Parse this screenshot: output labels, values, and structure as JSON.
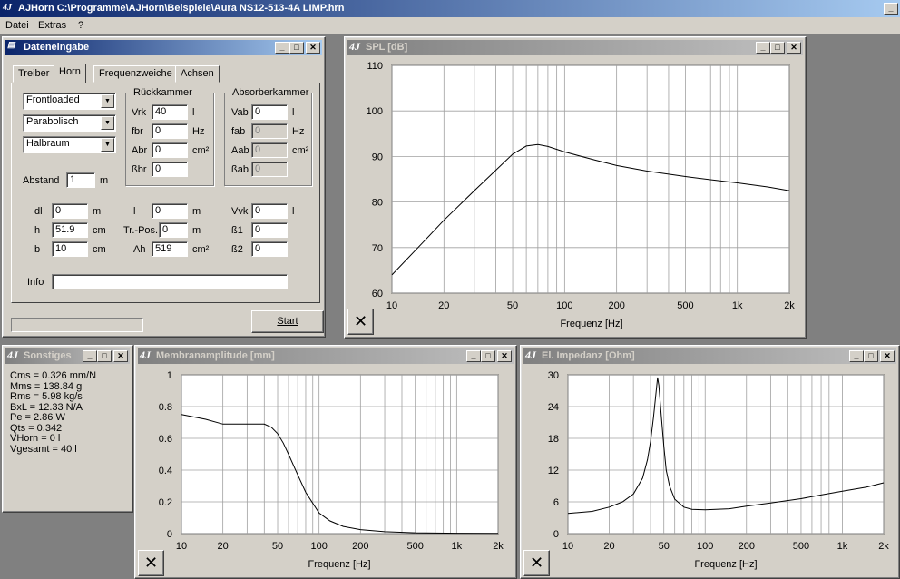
{
  "app": {
    "title": "AJHorn  C:\\Programme\\AJHorn\\Beispiele\\Aura NS12-513-4A LIMP.hrn",
    "icon": "aj-logo-icon"
  },
  "menu": [
    "Datei",
    "Extras",
    "?"
  ],
  "dateneingabe": {
    "title": "Dateneingabe",
    "tabs": [
      "Treiber",
      "Horn",
      "Frequenzweiche",
      "Achsen"
    ],
    "combos": [
      "Frontloaded",
      "Parabolisch",
      "Halbraum"
    ],
    "abstand": {
      "label": "Abstand",
      "value": "1",
      "unit": "m"
    },
    "rueckkammer": {
      "title": "Rückkammer",
      "rows": [
        {
          "label": "Vrk",
          "value": "40",
          "unit": "l"
        },
        {
          "label": "fbr",
          "value": "0",
          "unit": "Hz"
        },
        {
          "label": "Abr",
          "value": "0",
          "unit": "cm²"
        },
        {
          "label": "ßbr",
          "value": "0",
          "unit": ""
        }
      ]
    },
    "absorberkammer": {
      "title": "Absorberkammer",
      "rows": [
        {
          "label": "Vab",
          "value": "0",
          "unit": "l"
        },
        {
          "label": "fab",
          "value": "0",
          "unit": "Hz"
        },
        {
          "label": "Aab",
          "value": "0",
          "unit": "cm²"
        },
        {
          "label": "ßab",
          "value": "0",
          "unit": ""
        }
      ]
    },
    "col1": [
      {
        "label": "dl",
        "value": "0",
        "unit": "m"
      },
      {
        "label": "h",
        "value": "51.9",
        "unit": "cm"
      },
      {
        "label": "b",
        "value": "10",
        "unit": "cm"
      }
    ],
    "col2": [
      {
        "label": "l",
        "value": "0",
        "unit": "m"
      },
      {
        "label": "Tr.-Pos.",
        "value": "0",
        "unit": "m"
      },
      {
        "label": "Ah",
        "value": "519",
        "unit": "cm²"
      }
    ],
    "col3": [
      {
        "label": "Vvk",
        "value": "0",
        "unit": "l"
      },
      {
        "label": "ß1",
        "value": "0",
        "unit": ""
      },
      {
        "label": "ß2",
        "value": "0",
        "unit": ""
      }
    ],
    "info_label": "Info",
    "info_value": "",
    "start_label": "Start",
    "progress": 0
  },
  "sonstiges": {
    "title": "Sonstiges",
    "lines": [
      "Cms = 0.326 mm/N",
      "Mms = 138.84 g",
      "Rms = 5.98 kg/s",
      "BxL = 12.33 N/A",
      "Pe = 2.86 W",
      "Qts = 0.342",
      "VHorn = 0 l",
      "Vgesamt = 40 l"
    ]
  },
  "chart_data": [
    {
      "type": "line",
      "title": "SPL [dB]",
      "xlabel": "Frequenz [Hz]",
      "x_scale": "log",
      "xlim": [
        10,
        2000
      ],
      "ylim": [
        60,
        110
      ],
      "xticks": [
        "10",
        "20",
        "50",
        "100",
        "200",
        "500",
        "1k",
        "2k"
      ],
      "yticks": [
        "110",
        "100",
        "90",
        "80",
        "70",
        "60"
      ],
      "series": [
        {
          "x": [
            10,
            15,
            20,
            30,
            40,
            50,
            60,
            70,
            80,
            100,
            150,
            200,
            300,
            500,
            700,
            1000,
            1500,
            2000
          ],
          "y": [
            64,
            71,
            76,
            82.5,
            87,
            90.5,
            92.3,
            92.6,
            92.2,
            91,
            89.2,
            88,
            86.8,
            85.6,
            84.9,
            84.2,
            83.3,
            82.5
          ]
        }
      ]
    },
    {
      "type": "line",
      "title": "Membranamplitude [mm]",
      "xlabel": "Frequenz [Hz]",
      "x_scale": "log",
      "xlim": [
        10,
        2000
      ],
      "ylim": [
        0,
        1
      ],
      "xticks": [
        "10",
        "20",
        "50",
        "100",
        "200",
        "500",
        "1k",
        "2k"
      ],
      "yticks": [
        "1",
        "0.8",
        "0.6",
        "0.4",
        "0.2",
        "0"
      ],
      "series": [
        {
          "x": [
            10,
            15,
            20,
            30,
            40,
            45,
            50,
            55,
            60,
            70,
            80,
            100,
            120,
            150,
            200,
            300,
            500,
            1000,
            2000
          ],
          "y": [
            0.75,
            0.72,
            0.69,
            0.69,
            0.69,
            0.67,
            0.63,
            0.57,
            0.5,
            0.37,
            0.26,
            0.13,
            0.08,
            0.045,
            0.025,
            0.012,
            0.005,
            0.002,
            0.001
          ]
        }
      ]
    },
    {
      "type": "line",
      "title": "El. Impedanz [Ohm]",
      "xlabel": "Frequenz [Hz]",
      "x_scale": "log",
      "xlim": [
        10,
        2000
      ],
      "ylim": [
        0,
        30
      ],
      "xticks": [
        "10",
        "20",
        "50",
        "100",
        "200",
        "500",
        "1k",
        "2k"
      ],
      "yticks": [
        "30",
        "24",
        "18",
        "12",
        "6",
        "0"
      ],
      "series": [
        {
          "x": [
            10,
            15,
            20,
            25,
            30,
            35,
            38,
            40,
            42,
            44,
            45,
            46,
            48,
            50,
            52,
            55,
            60,
            70,
            80,
            100,
            150,
            200,
            300,
            500,
            700,
            1000,
            1500,
            2000
          ],
          "y": [
            3.8,
            4.2,
            5,
            6,
            7.5,
            10.5,
            14,
            17.5,
            22,
            27,
            29.5,
            28,
            22,
            16.5,
            12,
            9,
            6.5,
            5,
            4.6,
            4.5,
            4.7,
            5.2,
            5.8,
            6.6,
            7.3,
            8,
            8.8,
            9.6
          ]
        }
      ]
    }
  ]
}
